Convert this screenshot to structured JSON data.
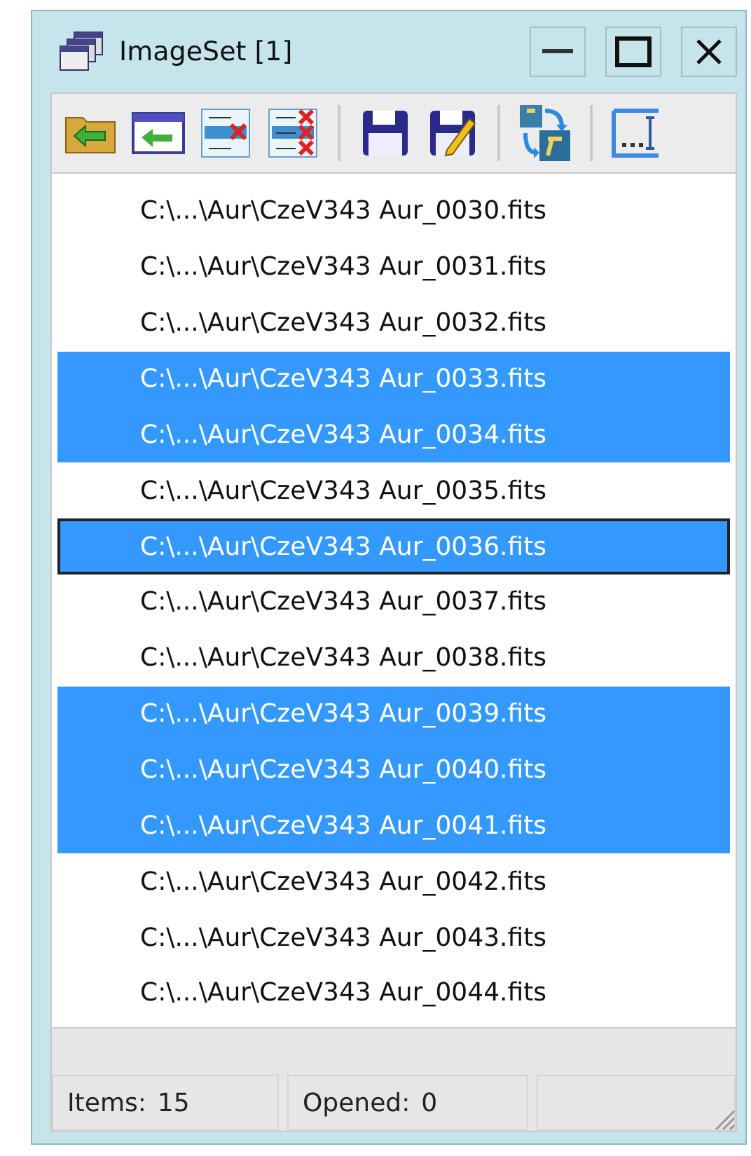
{
  "window": {
    "title": "ImageSet [1]"
  },
  "toolbar": {
    "groups": [
      [
        {
          "kind": "open"
        },
        {
          "kind": "import"
        },
        {
          "kind": "remove"
        },
        {
          "kind": "clear"
        }
      ],
      [
        {
          "kind": "save"
        },
        {
          "kind": "saveas"
        }
      ],
      [
        {
          "kind": "convert"
        }
      ],
      [
        {
          "kind": "rename"
        }
      ]
    ]
  },
  "files": [
    {
      "name": "C:\\...\\Aur\\CzeV343 Aur_0030.fits",
      "selected": false,
      "focused": false
    },
    {
      "name": "C:\\...\\Aur\\CzeV343 Aur_0031.fits",
      "selected": false,
      "focused": false
    },
    {
      "name": "C:\\...\\Aur\\CzeV343 Aur_0032.fits",
      "selected": false,
      "focused": false
    },
    {
      "name": "C:\\...\\Aur\\CzeV343 Aur_0033.fits",
      "selected": true,
      "focused": false
    },
    {
      "name": "C:\\...\\Aur\\CzeV343 Aur_0034.fits",
      "selected": true,
      "focused": false
    },
    {
      "name": "C:\\...\\Aur\\CzeV343 Aur_0035.fits",
      "selected": false,
      "focused": false
    },
    {
      "name": "C:\\...\\Aur\\CzeV343 Aur_0036.fits",
      "selected": true,
      "focused": true
    },
    {
      "name": "C:\\...\\Aur\\CzeV343 Aur_0037.fits",
      "selected": false,
      "focused": false
    },
    {
      "name": "C:\\...\\Aur\\CzeV343 Aur_0038.fits",
      "selected": false,
      "focused": false
    },
    {
      "name": "C:\\...\\Aur\\CzeV343 Aur_0039.fits",
      "selected": true,
      "focused": false
    },
    {
      "name": "C:\\...\\Aur\\CzeV343 Aur_0040.fits",
      "selected": true,
      "focused": false
    },
    {
      "name": "C:\\...\\Aur\\CzeV343 Aur_0041.fits",
      "selected": true,
      "focused": false
    },
    {
      "name": "C:\\...\\Aur\\CzeV343 Aur_0042.fits",
      "selected": false,
      "focused": false
    },
    {
      "name": "C:\\...\\Aur\\CzeV343 Aur_0043.fits",
      "selected": false,
      "focused": false
    },
    {
      "name": "C:\\...\\Aur\\CzeV343 Aur_0044.fits",
      "selected": false,
      "focused": false
    }
  ],
  "status_bar": [
    {
      "label": "Items:",
      "value": "15"
    },
    {
      "label": "Opened:",
      "value": "0"
    }
  ]
}
